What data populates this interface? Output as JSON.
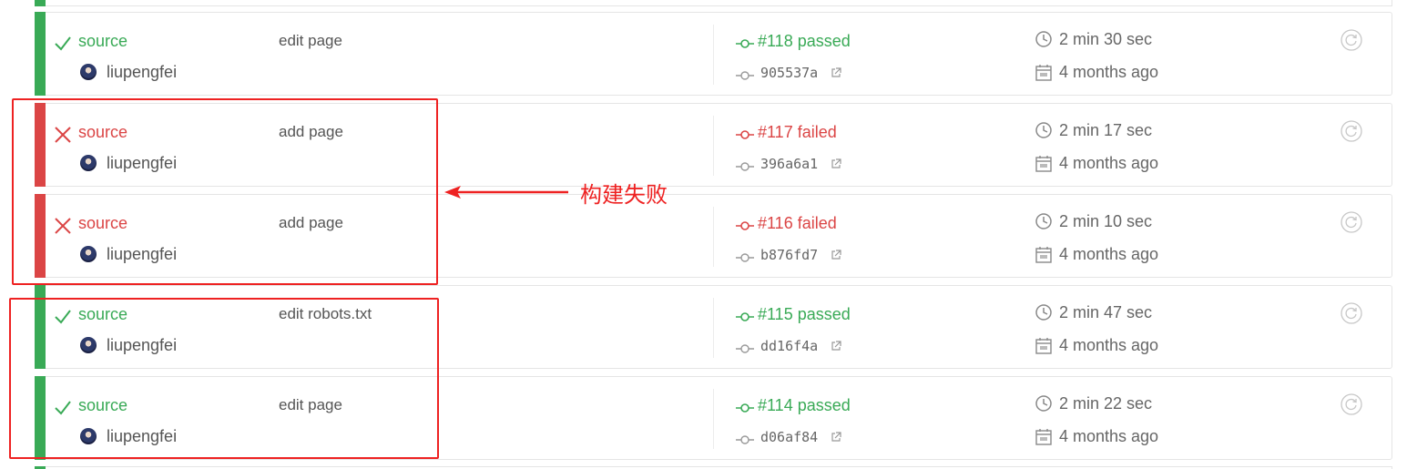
{
  "builds": [
    {
      "state": "passed",
      "branch": "source",
      "author": "liupengfei",
      "message": "edit page",
      "build": "#118 passed",
      "commit": "905537a",
      "duration": "2 min 30 sec",
      "finished": "4 months ago"
    },
    {
      "state": "failed",
      "branch": "source",
      "author": "liupengfei",
      "message": "add page",
      "build": "#117 failed",
      "commit": "396a6a1",
      "duration": "2 min 17 sec",
      "finished": "4 months ago"
    },
    {
      "state": "failed",
      "branch": "source",
      "author": "liupengfei",
      "message": "add page",
      "build": "#116 failed",
      "commit": "b876fd7",
      "duration": "2 min 10 sec",
      "finished": "4 months ago"
    },
    {
      "state": "passed",
      "branch": "source",
      "author": "liupengfei",
      "message": "edit robots.txt",
      "build": "#115 passed",
      "commit": "dd16f4a",
      "duration": "2 min 47 sec",
      "finished": "4 months ago"
    },
    {
      "state": "passed",
      "branch": "source",
      "author": "liupengfei",
      "message": "edit page",
      "build": "#114 passed",
      "commit": "d06af84",
      "duration": "2 min 22 sec",
      "finished": "4 months ago"
    }
  ],
  "annotation": {
    "label": "构建失败"
  },
  "colors": {
    "passed": "#39aa56",
    "failed": "#db4545",
    "annotation": "#ee2222"
  },
  "icons": {
    "passed": "check-icon",
    "failed": "cross-icon",
    "build": "commit-node-icon",
    "commit": "commit-node-icon",
    "external": "external-link-icon",
    "duration": "clock-icon",
    "finished": "calendar-icon",
    "restart": "restart-icon"
  }
}
